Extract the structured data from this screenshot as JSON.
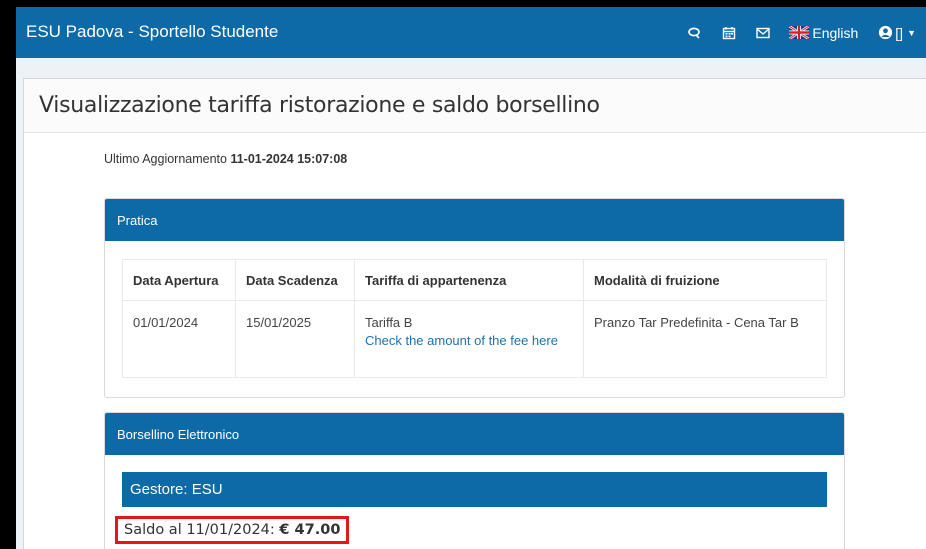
{
  "navbar": {
    "brand": "ESU Padova - Sportello Studente",
    "language": "English",
    "user_label": "[]",
    "icons": [
      "chat-icon",
      "calendar-icon",
      "mail-icon",
      "uk-flag-icon",
      "user-circle-icon",
      "caret-down-icon"
    ]
  },
  "page": {
    "title": "Visualizzazione tariffa ristorazione e saldo borsellino",
    "update_label": "Ultimo Aggiornamento",
    "update_value": "11-01-2024 15:07:08"
  },
  "pratica": {
    "title": "Pratica",
    "columns": [
      "Data Apertura",
      "Data Scadenza",
      "Tariffa di appartenenza",
      "Modalità di fruizione"
    ],
    "row": {
      "data_apertura": "01/01/2024",
      "data_scadenza": "15/01/2025",
      "tariffa": "Tariffa B",
      "tariffa_link": "Check the amount of the fee here",
      "modalita": "Pranzo Tar Predefinita - Cena Tar B"
    }
  },
  "borsellino": {
    "title": "Borsellino Elettronico",
    "gestore": "Gestore: ESU",
    "saldo_label": "Saldo al 11/01/2024:",
    "saldo_value": "€ 47.00"
  },
  "colors": {
    "primary": "#0e6aa7",
    "highlight": "#e2171b",
    "link": "#1c72b0"
  }
}
